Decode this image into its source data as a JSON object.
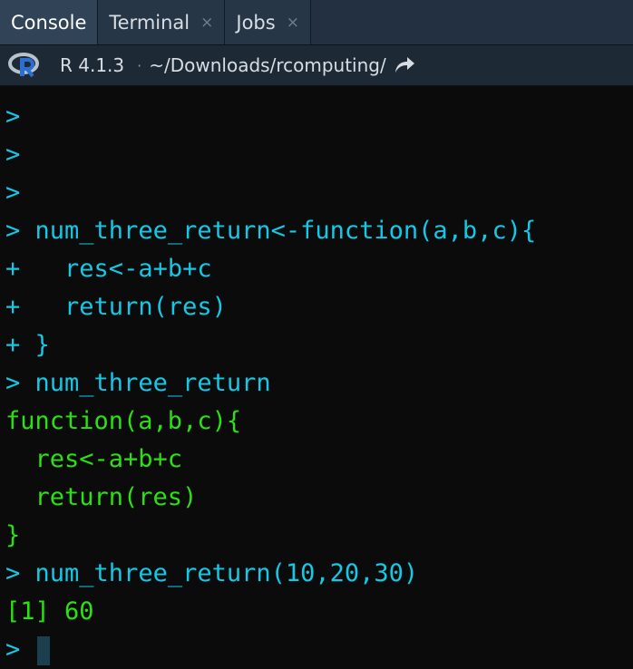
{
  "tabs": [
    {
      "label": "Console"
    },
    {
      "label": "Terminal",
      "close": "×"
    },
    {
      "label": "Jobs",
      "close": "×"
    }
  ],
  "infobar": {
    "version": "R 4.1.3",
    "separator": "·",
    "path": "~/Downloads/rcomputing/"
  },
  "console": {
    "lines": [
      {
        "prompt": ">",
        "code": ""
      },
      {
        "prompt": ">",
        "code": ""
      },
      {
        "prompt": ">",
        "code": ""
      },
      {
        "prompt": ">",
        "code": "num_three_return<-function(a,b,c){"
      },
      {
        "prompt": "+",
        "code": "  res<-a+b+c"
      },
      {
        "prompt": "+",
        "code": "  return(res)"
      },
      {
        "prompt": "+",
        "code": "}"
      },
      {
        "prompt": ">",
        "code": "num_three_return"
      }
    ],
    "output_lines": [
      "function(a,b,c){",
      "  res<-a+b+c",
      "  return(res)",
      "}"
    ],
    "call_line": {
      "prompt": ">",
      "code": "num_three_return(10,20,30)"
    },
    "result": "[1] 60",
    "final_prompt": ">"
  },
  "colors": {
    "input": "#14c8e6",
    "output": "#2be013",
    "background": "#0b0b0b"
  },
  "icons": [
    "r-logo-icon",
    "close-icon",
    "go-to-directory-icon"
  ]
}
